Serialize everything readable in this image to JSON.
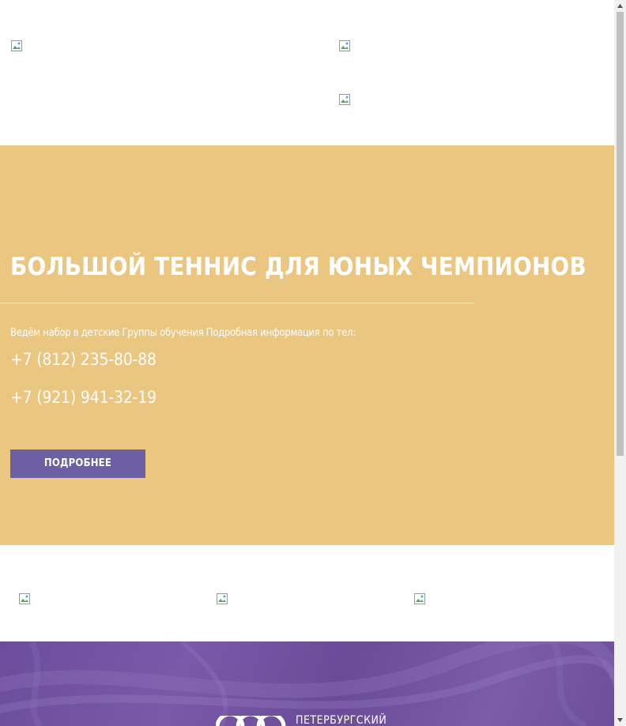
{
  "hero": {
    "title": "БОЛЬШОЙ ТЕННИС ДЛЯ ЮНЫХ ЧЕМПИОНОВ",
    "description": "Ведём набор в детские Группы обучения Подробная информация по тел:",
    "phone_1": "+7 (812) 235-80-88",
    "phone_2": "+7 (921) 941-32-19",
    "button_label": "ПОДРОБНЕЕ",
    "background_color": "#eac681",
    "button_color": "#6d5fa3"
  },
  "header": {
    "images": [
      "broken-image-icon",
      "broken-image-icon",
      "broken-image-icon"
    ]
  },
  "partners": {
    "images": [
      "broken-image-icon",
      "broken-image-icon",
      "broken-image-icon"
    ]
  },
  "footer": {
    "logo_text": "ПЕТЕРБУРГСКИЙ",
    "background_color": "#6b4d9c"
  },
  "scrollbar": {
    "up_icon": "arrow-up-icon",
    "down_icon": "arrow-down-icon"
  }
}
